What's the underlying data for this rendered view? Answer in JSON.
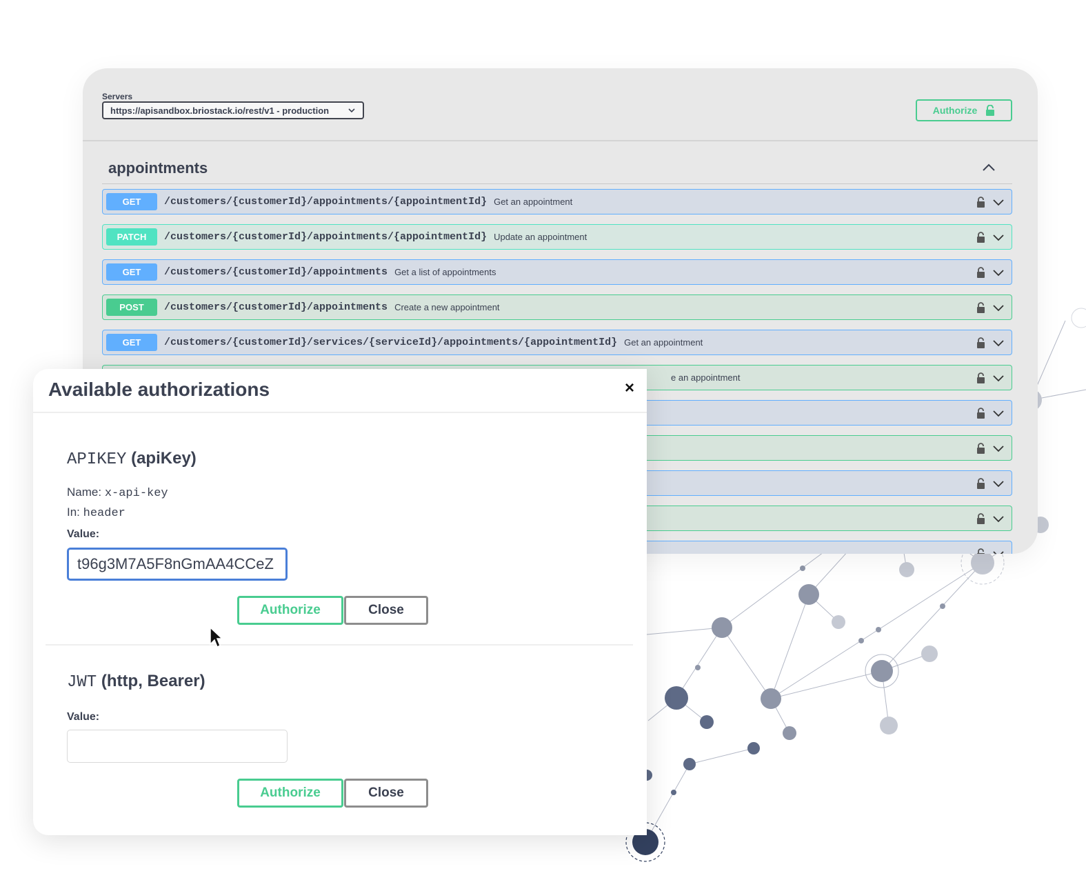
{
  "servers": {
    "label": "Servers",
    "selected": "https://apisandbox.briostack.io/rest/v1 - production"
  },
  "header": {
    "authorize_label": "Authorize"
  },
  "tag": {
    "name": "appointments"
  },
  "operations": [
    {
      "method": "GET",
      "path": "/customers/{customerId}/appointments/{appointmentId}",
      "summary": "Get an appointment"
    },
    {
      "method": "PATCH",
      "path": "/customers/{customerId}/appointments/{appointmentId}",
      "summary": "Update an appointment"
    },
    {
      "method": "GET",
      "path": "/customers/{customerId}/appointments",
      "summary": "Get a list of appointments"
    },
    {
      "method": "POST",
      "path": "/customers/{customerId}/appointments",
      "summary": "Create a new appointment"
    },
    {
      "method": "GET",
      "path": "/customers/{customerId}/services/{serviceId}/appointments/{appointmentId}",
      "summary": "Get an appointment"
    },
    {
      "method": "",
      "path": "",
      "summary": "e an appointment"
    }
  ],
  "modal": {
    "title": "Available authorizations",
    "close_glyph": "×",
    "apikey": {
      "title_mono": "APIKEY",
      "title_bold": "(apiKey)",
      "name_label": "Name:",
      "name_value": "x-api-key",
      "in_label": "In:",
      "in_value": "header",
      "value_label": "Value:",
      "value": "t96g3M7A5F8nGmAA4CCeZ",
      "authorize_label": "Authorize",
      "close_label": "Close"
    },
    "jwt": {
      "title_mono": "JWT",
      "title_bold": "(http, Bearer)",
      "value_label": "Value:",
      "value": "",
      "authorize_label": "Authorize",
      "close_label": "Close"
    }
  },
  "colors": {
    "get": "#61affe",
    "post": "#49cc90",
    "patch": "#50e3c2",
    "authorize": "#49cc90",
    "text": "#3b4151"
  },
  "icons": {
    "server_dropdown": "chevron-down-icon",
    "tag_toggle": "chevron-up-icon",
    "operation_lock": "lock-icon",
    "operation_expand": "chevron-down-icon",
    "modal_close": "close-icon",
    "cursor": "mouse-pointer-icon"
  }
}
